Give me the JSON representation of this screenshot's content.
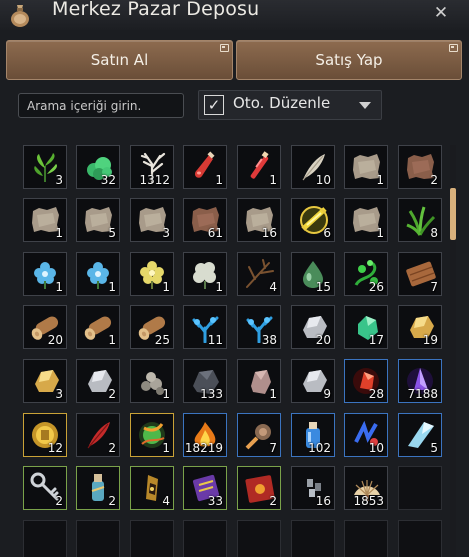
{
  "window": {
    "title": "Merkez Pazar Deposu",
    "close_glyph": "✕",
    "title_icon": "bag-icon"
  },
  "tabs": [
    {
      "label": "Satın Al"
    },
    {
      "label": "Satış Yap"
    }
  ],
  "search": {
    "placeholder": "Arama içeriği girin.",
    "value": ""
  },
  "auto_sort": {
    "label": "Oto. Düzenle",
    "checked": true,
    "check_glyph": "✓"
  },
  "colors": {
    "tab": "#7b5b42",
    "scroll_thumb": "#d8b07c",
    "gold_border": "#c9a237",
    "blue_border": "#3b74c0",
    "green_border": "#7aa24a",
    "purple_border": "#7d4cc0"
  },
  "items": [
    {
      "icon": "green-plant-icon",
      "count": "3",
      "border": "default"
    },
    {
      "icon": "green-coral-icon",
      "count": "32",
      "border": "default"
    },
    {
      "icon": "white-branch-icon",
      "count": "1312",
      "border": "default"
    },
    {
      "icon": "red-potion-icon",
      "count": "1",
      "border": "default"
    },
    {
      "icon": "red-vial-icon",
      "count": "1",
      "border": "default"
    },
    {
      "icon": "feather-icon",
      "count": "10",
      "border": "default"
    },
    {
      "icon": "hide-icon",
      "count": "1",
      "border": "default"
    },
    {
      "icon": "leather-icon",
      "count": "2",
      "border": "default"
    },
    {
      "icon": "hide-icon",
      "count": "1",
      "border": "default"
    },
    {
      "icon": "hide-icon",
      "count": "5",
      "border": "default"
    },
    {
      "icon": "hide-icon",
      "count": "3",
      "border": "default"
    },
    {
      "icon": "leather-icon",
      "count": "61",
      "border": "default"
    },
    {
      "icon": "hide-icon",
      "count": "16",
      "border": "default"
    },
    {
      "icon": "gold-scroll-icon",
      "count": "6",
      "border": "default"
    },
    {
      "icon": "hide-icon",
      "count": "1",
      "border": "default"
    },
    {
      "icon": "grass-icon",
      "count": "8",
      "border": "default"
    },
    {
      "icon": "blue-flower-icon",
      "count": "1",
      "border": "default"
    },
    {
      "icon": "blue-flower-icon",
      "count": "1",
      "border": "default"
    },
    {
      "icon": "yellow-flower-icon",
      "count": "1",
      "border": "default"
    },
    {
      "icon": "white-flower-icon",
      "count": "1",
      "border": "default"
    },
    {
      "icon": "twig-icon",
      "count": "4",
      "border": "default"
    },
    {
      "icon": "green-drop-icon",
      "count": "15",
      "border": "default"
    },
    {
      "icon": "green-vine-icon",
      "count": "26",
      "border": "default"
    },
    {
      "icon": "wood-plank-icon",
      "count": "7",
      "border": "default"
    },
    {
      "icon": "log-icon",
      "count": "20",
      "border": "default"
    },
    {
      "icon": "log-icon",
      "count": "1",
      "border": "default"
    },
    {
      "icon": "log-icon",
      "count": "25",
      "border": "default"
    },
    {
      "icon": "blue-coral-icon",
      "count": "11",
      "border": "default"
    },
    {
      "icon": "blue-coral-icon",
      "count": "38",
      "border": "default"
    },
    {
      "icon": "silver-ore-icon",
      "count": "20",
      "border": "default"
    },
    {
      "icon": "green-gem-icon",
      "count": "17",
      "border": "default"
    },
    {
      "icon": "gold-ore-icon",
      "count": "19",
      "border": "default"
    },
    {
      "icon": "gold-ore-icon",
      "count": "3",
      "border": "default"
    },
    {
      "icon": "silver-ore-icon",
      "count": "2",
      "border": "default"
    },
    {
      "icon": "stone-pile-icon",
      "count": "1",
      "border": "default"
    },
    {
      "icon": "dark-stone-icon",
      "count": "133",
      "border": "default"
    },
    {
      "icon": "pink-stone-icon",
      "count": "1",
      "border": "default"
    },
    {
      "icon": "silver-ore-icon",
      "count": "9",
      "border": "default"
    },
    {
      "icon": "red-crystal-icon",
      "count": "28",
      "border": "blue"
    },
    {
      "icon": "purple-crystal-icon",
      "count": "7188",
      "border": "blue"
    },
    {
      "icon": "gold-coin-icon",
      "count": "12",
      "border": "gold"
    },
    {
      "icon": "red-feather-icon",
      "count": "2",
      "border": "default"
    },
    {
      "icon": "green-orb-icon",
      "count": "1",
      "border": "gold"
    },
    {
      "icon": "fire-ember-icon",
      "count": "18219",
      "border": "blue"
    },
    {
      "icon": "meteor-icon",
      "count": "7",
      "border": "blue"
    },
    {
      "icon": "blue-bottle-icon",
      "count": "102",
      "border": "blue"
    },
    {
      "icon": "blue-rune-icon",
      "count": "10",
      "border": "blue"
    },
    {
      "icon": "ice-crystal-icon",
      "count": "5",
      "border": "blue"
    },
    {
      "icon": "key-icon",
      "count": "2",
      "border": "green"
    },
    {
      "icon": "bottle-icon",
      "count": "2",
      "border": "green"
    },
    {
      "icon": "amulet-icon",
      "count": "4",
      "border": "green"
    },
    {
      "icon": "purple-scroll-icon",
      "count": "33",
      "border": "green"
    },
    {
      "icon": "red-book-icon",
      "count": "2",
      "border": "green"
    },
    {
      "icon": "fragment-icon",
      "count": "16",
      "border": "default"
    },
    {
      "icon": "fan-icon",
      "count": "1853",
      "border": "default"
    },
    {
      "icon": "",
      "count": "",
      "border": "empty"
    },
    {
      "icon": "",
      "count": "",
      "border": "empty"
    },
    {
      "icon": "",
      "count": "",
      "border": "empty"
    },
    {
      "icon": "",
      "count": "",
      "border": "empty"
    },
    {
      "icon": "",
      "count": "",
      "border": "empty"
    },
    {
      "icon": "",
      "count": "",
      "border": "empty"
    },
    {
      "icon": "",
      "count": "",
      "border": "empty"
    },
    {
      "icon": "",
      "count": "",
      "border": "empty"
    },
    {
      "icon": "",
      "count": "",
      "border": "empty"
    }
  ]
}
